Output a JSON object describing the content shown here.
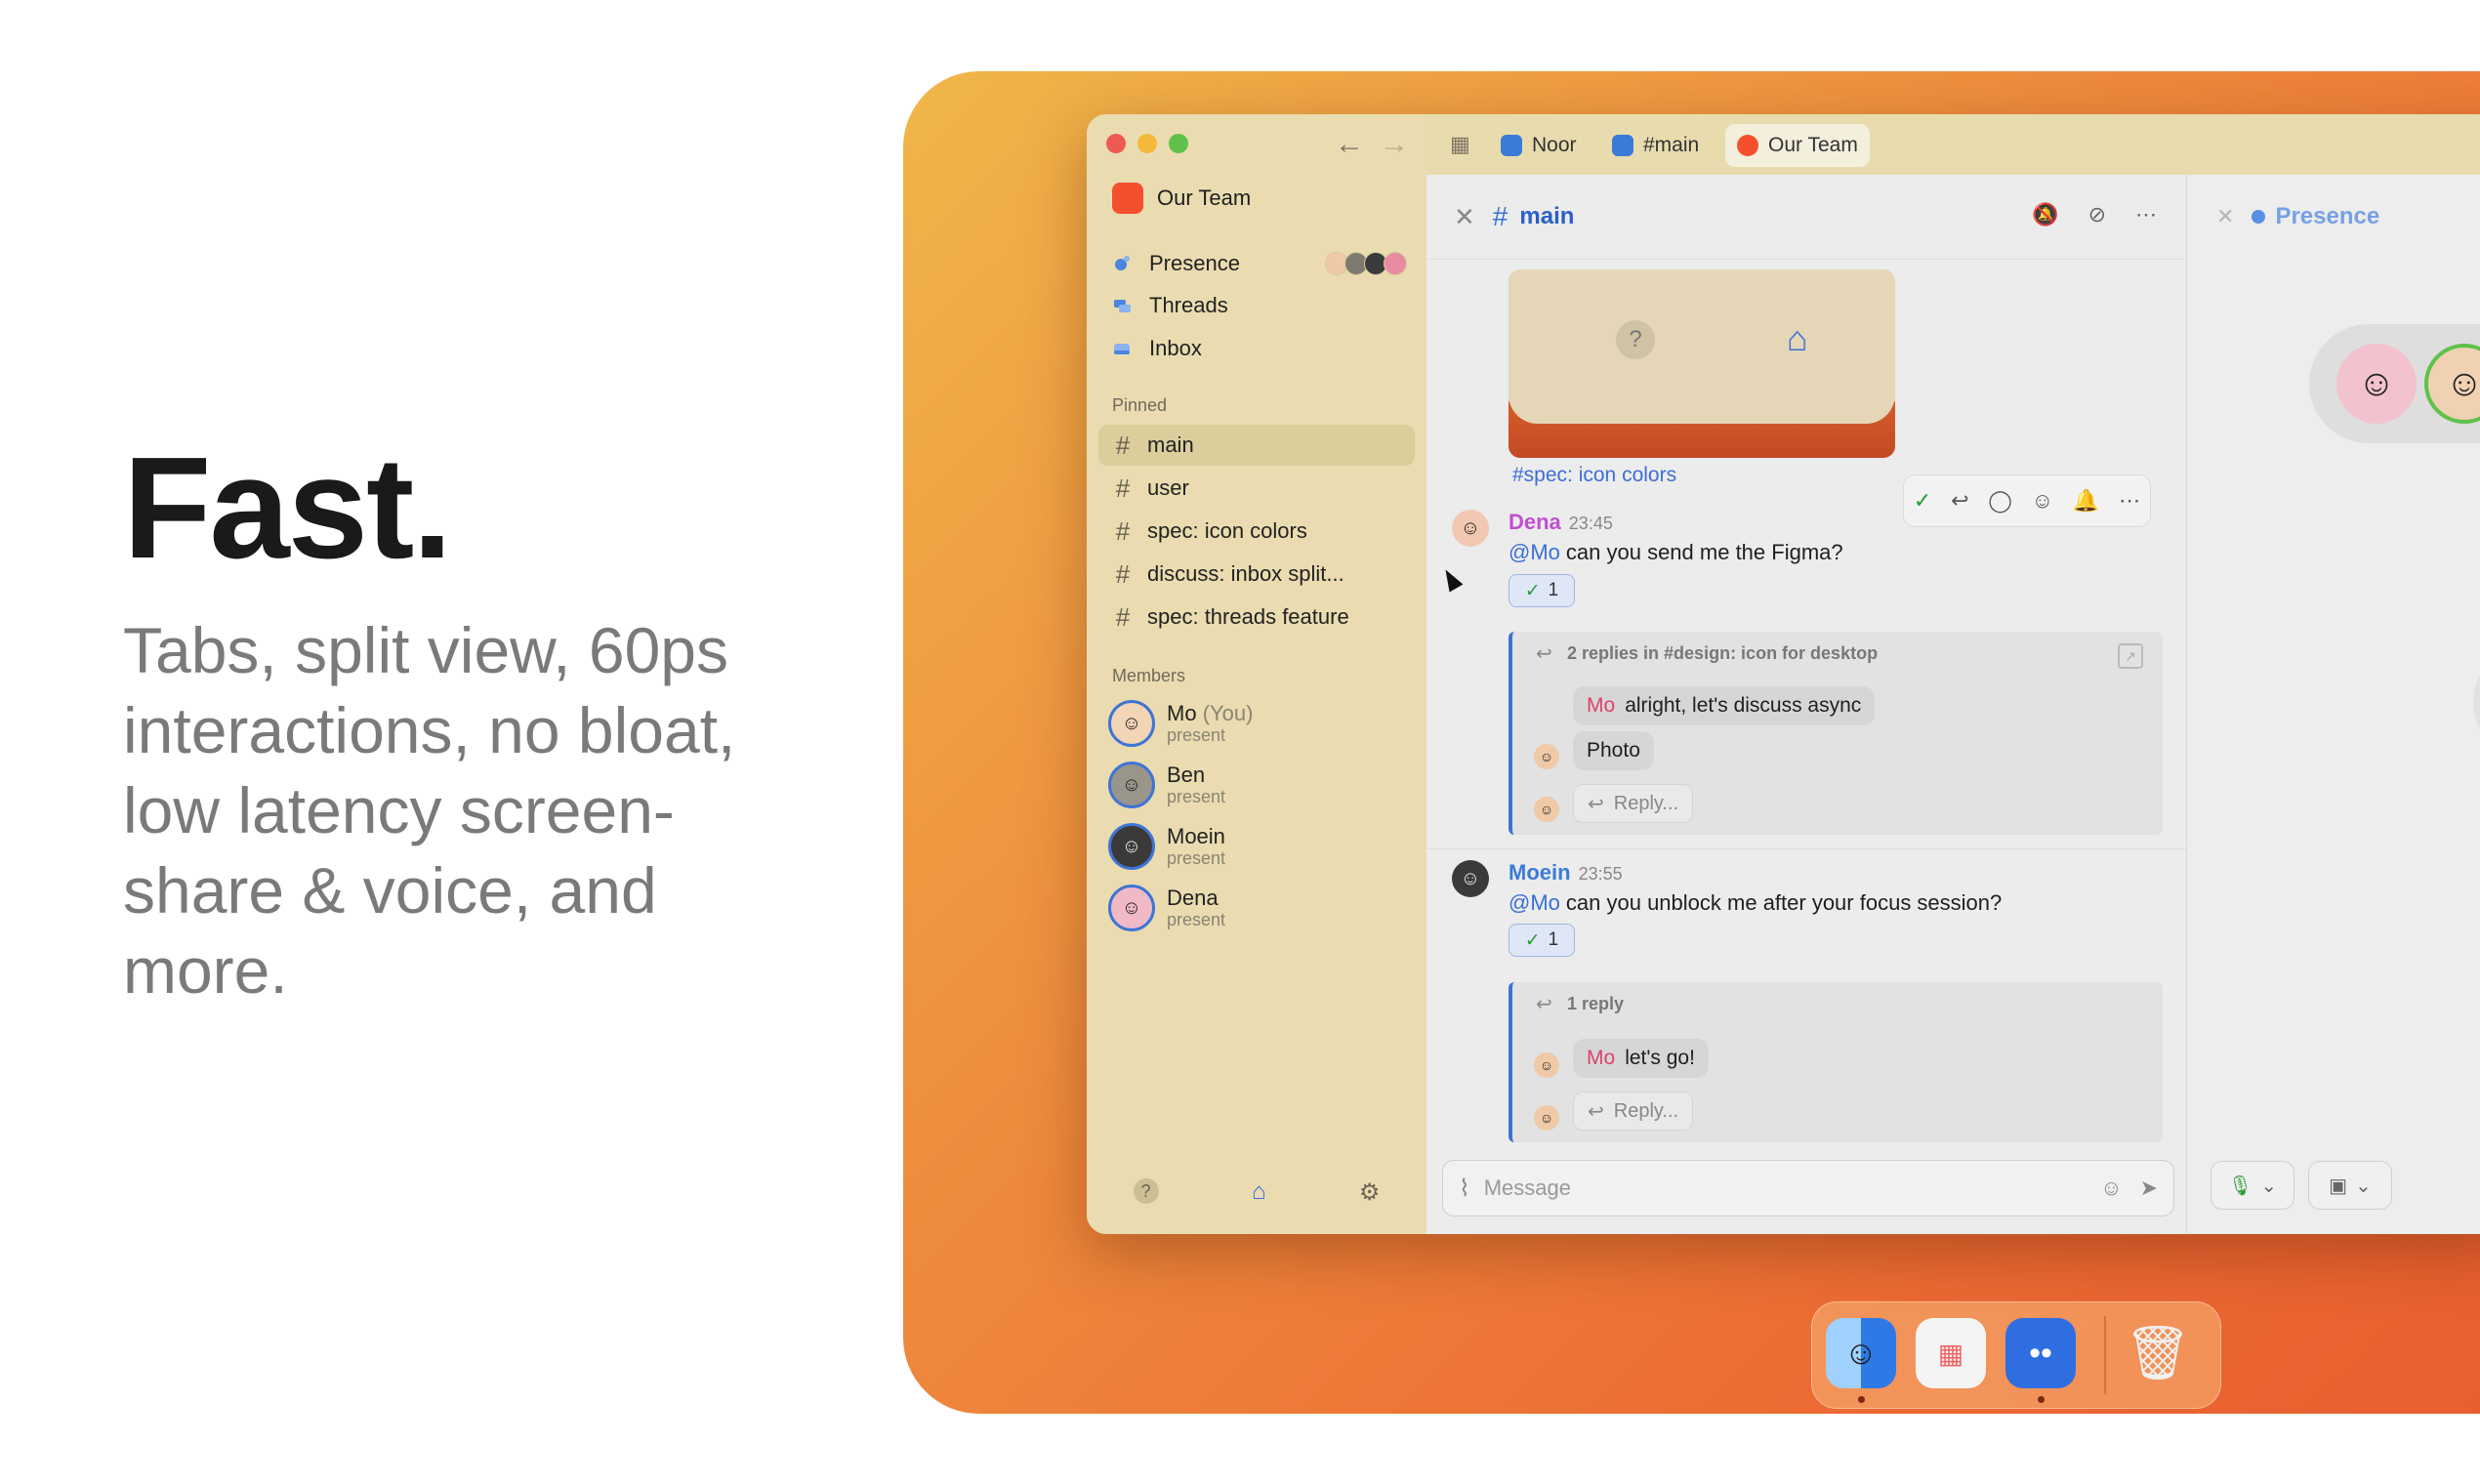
{
  "hero": {
    "title": "Fast.",
    "subtitle": "Tabs, split view, 60ps interactions, no bloat, low latency screen-share & voice, and more."
  },
  "sidebar": {
    "team_name": "Our Team",
    "nav": [
      {
        "label": "Presence",
        "icon": "presence-icon"
      },
      {
        "label": "Threads",
        "icon": "threads-icon"
      },
      {
        "label": "Inbox",
        "icon": "inbox-icon"
      }
    ],
    "pinned_label": "Pinned",
    "channels": [
      "main",
      "user",
      "spec: icon colors",
      "discuss: inbox split...",
      "spec: threads feature"
    ],
    "members_label": "Members",
    "members": [
      {
        "name": "Mo",
        "suffix": "(You)",
        "status": "present"
      },
      {
        "name": "Ben",
        "suffix": "",
        "status": "present"
      },
      {
        "name": "Moein",
        "suffix": "",
        "status": "present"
      },
      {
        "name": "Dena",
        "suffix": "",
        "status": "present"
      }
    ]
  },
  "tabs": [
    "Noor",
    "#main",
    "Our Team"
  ],
  "channel": {
    "name": "main",
    "preview_link": "#spec: icon colors",
    "messages": [
      {
        "author": "Dena",
        "time": "23:45",
        "mention": "@Mo",
        "text": "can you send me the Figma?",
        "reaction_count": "1",
        "thread_head": "2 replies in #design: icon for desktop",
        "thread_pills": [
          {
            "who": "Mo",
            "text": "alright, let's discuss async"
          },
          {
            "who": "",
            "text": "Photo"
          }
        ],
        "reply_placeholder": "Reply..."
      },
      {
        "author": "Moein",
        "time": "23:55",
        "mention": "@Mo",
        "text": "can you unblock me after your focus session?",
        "reaction_count": "1",
        "thread_head": "1 reply",
        "thread_pills": [
          {
            "who": "Mo",
            "text": "let's go!"
          }
        ],
        "reply_placeholder": "Reply..."
      }
    ],
    "composer_placeholder": "Message"
  },
  "right_pane": {
    "title": "Presence"
  },
  "colors": {
    "accent": "#3b6fd6",
    "team": "#f4502e",
    "mention_name": "#e0426e",
    "dena_name": "#c04fcf",
    "moein_name": "#3b7bd8"
  }
}
